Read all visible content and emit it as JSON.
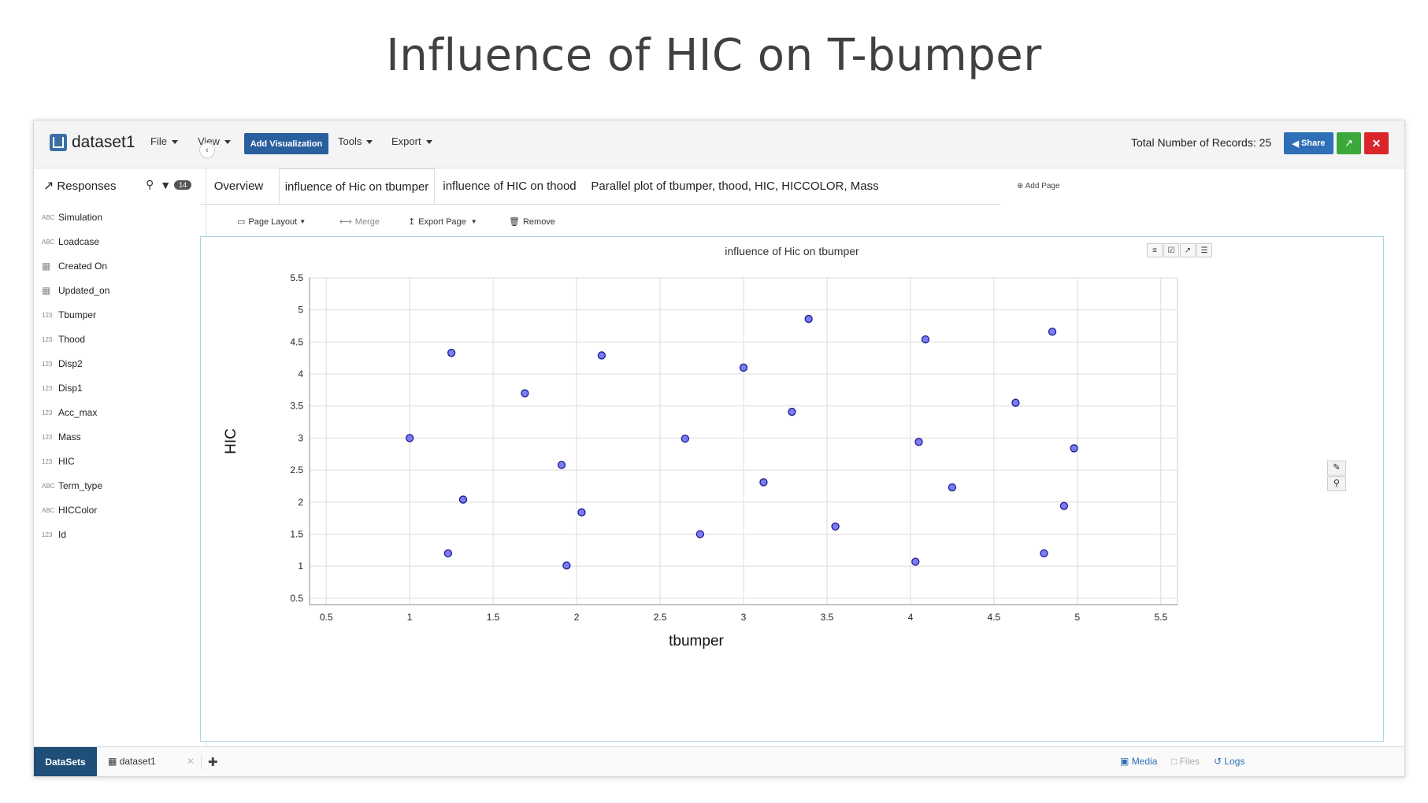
{
  "slide_title": "Influence of HIC on T-bumper",
  "app": {
    "dataset_name": "dataset1",
    "menus": [
      "File",
      "View",
      "Tools",
      "Export"
    ],
    "add_visualization": "Add Visualization",
    "records_text": "Total Number of Records: 25",
    "share_label": "Share"
  },
  "sidebar": {
    "title": "Responses",
    "filter_count": "14",
    "fields": [
      {
        "type": "ABC",
        "name": "Simulation"
      },
      {
        "type": "ABC",
        "name": "Loadcase"
      },
      {
        "type": "table",
        "name": "Created On"
      },
      {
        "type": "table",
        "name": "Updated_on"
      },
      {
        "type": "123",
        "name": "Tbumper"
      },
      {
        "type": "123",
        "name": "Thood"
      },
      {
        "type": "123",
        "name": "Disp2"
      },
      {
        "type": "123",
        "name": "Disp1"
      },
      {
        "type": "123",
        "name": "Acc_max"
      },
      {
        "type": "123",
        "name": "Mass"
      },
      {
        "type": "123",
        "name": "HIC"
      },
      {
        "type": "ABC",
        "name": "Term_type"
      },
      {
        "type": "ABC",
        "name": "HICColor"
      },
      {
        "type": "123",
        "name": "Id"
      }
    ]
  },
  "tabs": [
    "Overview",
    "influence of Hic on tbumper",
    "influence of HIC on thood",
    "Parallel plot of tbumper, thood, HIC, HICCOLOR, Mass"
  ],
  "add_page": "Add Page",
  "page_toolbar": {
    "page_layout": "Page Layout",
    "merge": "Merge",
    "export_page": "Export Page",
    "remove": "Remove"
  },
  "bottom": {
    "datasets_tab": "DataSets",
    "dataset_item": "dataset1",
    "media": "Media",
    "files": "Files",
    "logs": "Logs"
  },
  "colors": {
    "accent": "#2a5f9e",
    "point_fill": "#7b7bf5",
    "point_stroke": "#1c1c8c"
  },
  "chart_data": {
    "type": "scatter",
    "title": "influence of Hic on tbumper",
    "xlabel": "tbumper",
    "ylabel": "HIC",
    "xlim": [
      0.4,
      5.6
    ],
    "ylim": [
      0.4,
      5.5
    ],
    "xticks": [
      0.5,
      1,
      1.5,
      2,
      2.5,
      3,
      3.5,
      4,
      4.5,
      5,
      5.5
    ],
    "yticks": [
      0.5,
      1,
      1.5,
      2,
      2.5,
      3,
      3.5,
      4,
      4.5,
      5,
      5.5
    ],
    "grid": true,
    "points": [
      {
        "x": 1.0,
        "y": 3.0
      },
      {
        "x": 1.25,
        "y": 4.33
      },
      {
        "x": 1.32,
        "y": 2.04
      },
      {
        "x": 1.23,
        "y": 1.2
      },
      {
        "x": 1.69,
        "y": 3.7
      },
      {
        "x": 1.91,
        "y": 2.58
      },
      {
        "x": 1.94,
        "y": 1.01
      },
      {
        "x": 2.03,
        "y": 1.84
      },
      {
        "x": 2.15,
        "y": 4.29
      },
      {
        "x": 2.65,
        "y": 2.99
      },
      {
        "x": 2.74,
        "y": 1.5
      },
      {
        "x": 3.0,
        "y": 4.1
      },
      {
        "x": 3.12,
        "y": 2.31
      },
      {
        "x": 3.29,
        "y": 3.41
      },
      {
        "x": 3.39,
        "y": 4.86
      },
      {
        "x": 3.55,
        "y": 1.62
      },
      {
        "x": 4.03,
        "y": 1.07
      },
      {
        "x": 4.05,
        "y": 2.94
      },
      {
        "x": 4.09,
        "y": 4.54
      },
      {
        "x": 4.25,
        "y": 2.23
      },
      {
        "x": 4.63,
        "y": 3.55
      },
      {
        "x": 4.8,
        "y": 1.2
      },
      {
        "x": 4.85,
        "y": 4.66
      },
      {
        "x": 4.92,
        "y": 1.94
      },
      {
        "x": 4.98,
        "y": 2.84
      }
    ]
  }
}
